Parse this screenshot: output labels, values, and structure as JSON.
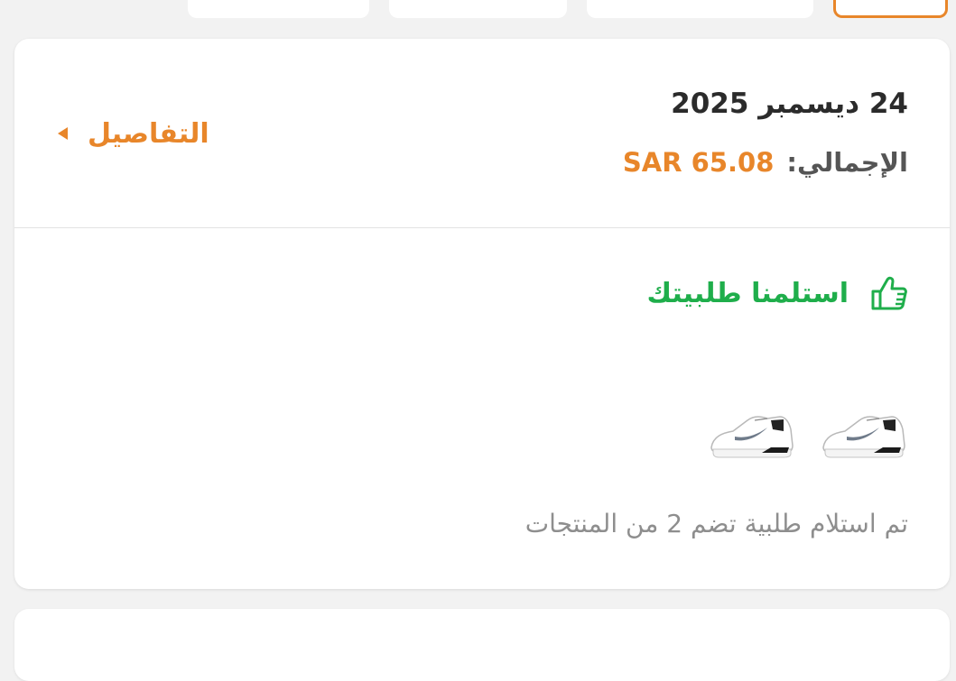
{
  "order": {
    "date": "24 ديسمبر 2025",
    "total_label": "الإجمالي:",
    "total_value": "SAR 65.08",
    "details_label": "التفاصيل",
    "status_text": "استلمنا طلبيتك",
    "status_icon": "thumbs-up-icon",
    "products": [
      {
        "name": "white-sneaker"
      },
      {
        "name": "white-sneaker"
      }
    ],
    "summary": "تم استلام طلبية تضم 2 من المنتجات"
  },
  "colors": {
    "accent": "#e8862a",
    "success": "#1fae4b",
    "text_primary": "#2b2b2b",
    "text_muted": "#8e8e8e",
    "background": "#f2f2f2"
  }
}
